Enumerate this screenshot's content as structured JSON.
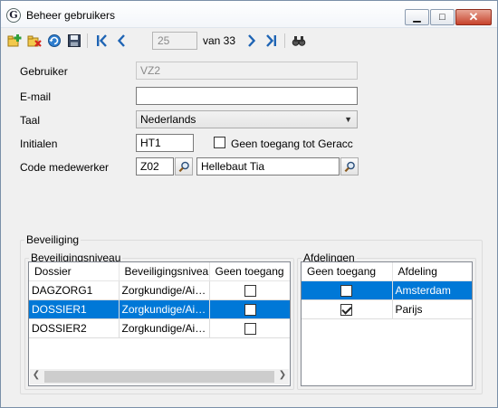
{
  "window": {
    "title": "Beheer gebruikers",
    "app_icon_letter": "G",
    "controls": {
      "minimize": "▭",
      "maximize": "□",
      "close": "✕"
    }
  },
  "toolbar": {
    "icons": [
      "new-record-icon",
      "delete-record-icon",
      "refresh-icon",
      "save-icon",
      "first-record-icon",
      "previous-record-icon",
      "next-record-icon",
      "last-record-icon",
      "find-icon"
    ],
    "record_position": "25",
    "record_total": "van 33"
  },
  "form": {
    "user_label": "Gebruiker",
    "user_value": "VZ2",
    "email_label": "E-mail",
    "email_value": "",
    "language_label": "Taal",
    "language_value": "Nederlands",
    "initials_label": "Initialen",
    "initials_value": "HT1",
    "no_access_label": "Geen toegang tot Geracc",
    "no_access_checked": false,
    "employee_label": "Code medewerker",
    "employee_code": "Z02",
    "employee_name": "Hellebaut Tia"
  },
  "security": {
    "group_title": "Beveiliging",
    "level_group_title": "Beveiligingsniveau",
    "level_columns": [
      "Dossier",
      "Beveiligingsniveau",
      "Geen toegang"
    ],
    "level_rows": [
      {
        "dossier": "DAGZORG1",
        "level": "Zorgkundige/Aid...",
        "no_access": false,
        "selected": false
      },
      {
        "dossier": "DOSSIER1",
        "level": "Zorgkundige/Aid...",
        "no_access": false,
        "selected": true
      },
      {
        "dossier": "DOSSIER2",
        "level": "Zorgkundige/Aid...",
        "no_access": false,
        "selected": false
      }
    ],
    "departments_group_title": "Afdelingen",
    "department_columns": [
      "Geen toegang",
      "Afdeling"
    ],
    "department_rows": [
      {
        "no_access": false,
        "name": "Amsterdam",
        "selected": true
      },
      {
        "no_access": true,
        "name": "Parijs",
        "selected": false
      }
    ]
  },
  "colors": {
    "selection": "#0078d7",
    "window_bg": "#f0f0f0"
  }
}
